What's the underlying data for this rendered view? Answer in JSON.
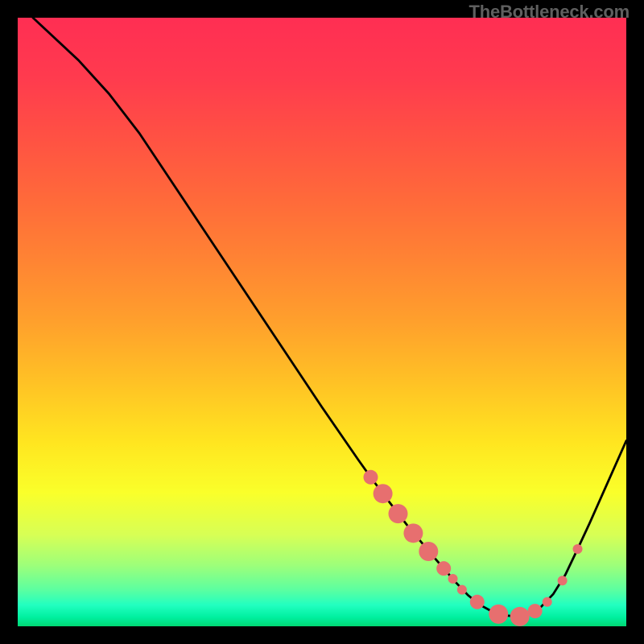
{
  "watermark": "TheBottleneck.com",
  "gradient": {
    "stops": [
      {
        "offset": 0.0,
        "color": "#ff2e53"
      },
      {
        "offset": 0.1,
        "color": "#ff3b4e"
      },
      {
        "offset": 0.2,
        "color": "#ff5243"
      },
      {
        "offset": 0.3,
        "color": "#ff6a3a"
      },
      {
        "offset": 0.4,
        "color": "#ff8433"
      },
      {
        "offset": 0.5,
        "color": "#ffa02c"
      },
      {
        "offset": 0.6,
        "color": "#ffc225"
      },
      {
        "offset": 0.7,
        "color": "#ffe620"
      },
      {
        "offset": 0.78,
        "color": "#faff2a"
      },
      {
        "offset": 0.85,
        "color": "#d7ff55"
      },
      {
        "offset": 0.9,
        "color": "#9dff7a"
      },
      {
        "offset": 0.94,
        "color": "#5cffa0"
      },
      {
        "offset": 0.965,
        "color": "#22ffc0"
      },
      {
        "offset": 0.985,
        "color": "#00f0a0"
      },
      {
        "offset": 1.0,
        "color": "#00d873"
      }
    ]
  },
  "curve_style": {
    "stroke": "#000000",
    "stroke_width": 2.8
  },
  "marker_style": {
    "fill": "#e76f6f",
    "radius_small": 6,
    "radius_med": 9,
    "radius_large": 12
  },
  "chart_data": {
    "type": "line",
    "title": "",
    "xlabel": "",
    "ylabel": "",
    "xlim": [
      0,
      100
    ],
    "ylim": [
      0,
      100
    ],
    "curve": [
      {
        "x": 2.5,
        "y": 100.0
      },
      {
        "x": 10.0,
        "y": 93.0
      },
      {
        "x": 15.0,
        "y": 87.5
      },
      {
        "x": 20.0,
        "y": 81.0
      },
      {
        "x": 28.0,
        "y": 69.0
      },
      {
        "x": 35.0,
        "y": 58.5
      },
      {
        "x": 42.0,
        "y": 48.0
      },
      {
        "x": 50.0,
        "y": 36.0
      },
      {
        "x": 56.0,
        "y": 27.3
      },
      {
        "x": 58.0,
        "y": 24.5
      },
      {
        "x": 60.0,
        "y": 21.8
      },
      {
        "x": 62.0,
        "y": 19.2
      },
      {
        "x": 64.0,
        "y": 16.6
      },
      {
        "x": 66.0,
        "y": 14.2
      },
      {
        "x": 68.0,
        "y": 11.8
      },
      {
        "x": 70.0,
        "y": 9.5
      },
      {
        "x": 72.0,
        "y": 7.2
      },
      {
        "x": 74.0,
        "y": 5.1
      },
      {
        "x": 76.0,
        "y": 3.5
      },
      {
        "x": 78.0,
        "y": 2.4
      },
      {
        "x": 80.0,
        "y": 1.8
      },
      {
        "x": 82.0,
        "y": 1.6
      },
      {
        "x": 84.0,
        "y": 2.0
      },
      {
        "x": 86.0,
        "y": 3.2
      },
      {
        "x": 88.0,
        "y": 5.3
      },
      {
        "x": 90.0,
        "y": 8.5
      },
      {
        "x": 92.0,
        "y": 12.7
      },
      {
        "x": 94.0,
        "y": 17.0
      },
      {
        "x": 96.0,
        "y": 21.5
      },
      {
        "x": 98.0,
        "y": 26.0
      },
      {
        "x": 100.0,
        "y": 30.5
      }
    ],
    "markers": [
      {
        "x": 58.0,
        "y": 24.5,
        "size": "med"
      },
      {
        "x": 60.0,
        "y": 21.8,
        "size": "large"
      },
      {
        "x": 62.5,
        "y": 18.5,
        "size": "large"
      },
      {
        "x": 65.0,
        "y": 15.3,
        "size": "large"
      },
      {
        "x": 67.5,
        "y": 12.3,
        "size": "large"
      },
      {
        "x": 70.0,
        "y": 9.5,
        "size": "med"
      },
      {
        "x": 71.5,
        "y": 7.8,
        "size": "small"
      },
      {
        "x": 73.0,
        "y": 6.0,
        "size": "small"
      },
      {
        "x": 75.5,
        "y": 4.0,
        "size": "med"
      },
      {
        "x": 79.0,
        "y": 2.0,
        "size": "large"
      },
      {
        "x": 82.5,
        "y": 1.6,
        "size": "large"
      },
      {
        "x": 85.0,
        "y": 2.5,
        "size": "med"
      },
      {
        "x": 87.0,
        "y": 4.0,
        "size": "small"
      },
      {
        "x": 89.5,
        "y": 7.5,
        "size": "small"
      },
      {
        "x": 92.0,
        "y": 12.7,
        "size": "small"
      }
    ]
  }
}
